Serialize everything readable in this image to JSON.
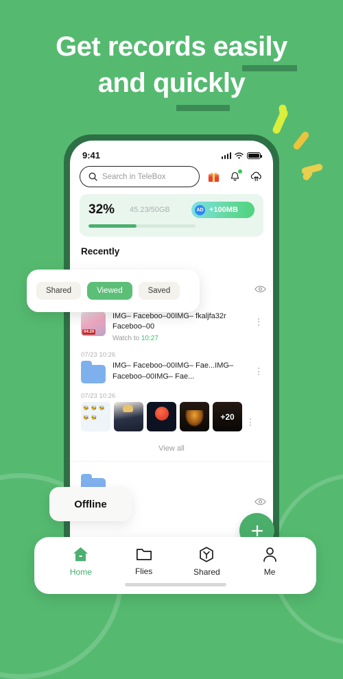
{
  "colors": {
    "background": "#55BA70",
    "phone_frame": "#2E7045",
    "accent_green": "#4CAF6E",
    "active_chip": "#5CBF78",
    "underline": "#3C8A55",
    "spark_lime": "#D9EF3B",
    "spark_gold": "#ECC43C",
    "ad_blue": "#2F86F6",
    "folder_blue": "#7FB0EE"
  },
  "headline": {
    "line1": "Get records easily",
    "line2": "and quickly"
  },
  "phone": {
    "status": {
      "time": "9:41",
      "signal_icon": "signal-bars-icon",
      "wifi_icon": "wifi-icon",
      "battery_icon": "battery-icon"
    },
    "search": {
      "placeholder": "Search in TeleBox",
      "icon": "search-icon"
    },
    "header_icons": [
      {
        "name": "gift-icon",
        "glyph": "🎁"
      },
      {
        "name": "notification-bell-icon",
        "has_dot": true
      },
      {
        "name": "cloud-transfer-icon"
      }
    ],
    "storage": {
      "percent": "32%",
      "used": "45.23/50GB",
      "progress": 45,
      "ad_badge": "AD",
      "ad_label": "+100MB"
    },
    "section_title": "Recently",
    "items": [
      {
        "date": "07/23 10:26",
        "type": "video",
        "duration": "04:20",
        "title": "IMG– Faceboo–00IMG– fkaljfa32r Faceboo–00",
        "sub_prefix": "Watch to ",
        "sub_value": "10:27"
      },
      {
        "date": "07/23 10:26",
        "type": "folder",
        "title": "IMG– Faceboo–00IMG– Fae...IMG– Faceboo–00IMG– Fae..."
      },
      {
        "date": "07/23 10:26",
        "type": "photos",
        "overflow_count": "+20"
      }
    ],
    "view_all": "View all"
  },
  "overlays": {
    "chips": [
      {
        "label": "Shared",
        "active": false
      },
      {
        "label": "Viewed",
        "active": true
      },
      {
        "label": "Saved",
        "active": false
      }
    ],
    "eye_icon": "eye-icon",
    "offline_label": "Offline",
    "fab_icon": "plus-icon"
  },
  "bottom_nav": [
    {
      "label": "Home",
      "icon": "home-icon",
      "active": true
    },
    {
      "label": "Flies",
      "icon": "folder-icon",
      "active": false
    },
    {
      "label": "Shared",
      "icon": "cube-share-icon",
      "active": false
    },
    {
      "label": "Me",
      "icon": "person-icon",
      "active": false
    }
  ]
}
